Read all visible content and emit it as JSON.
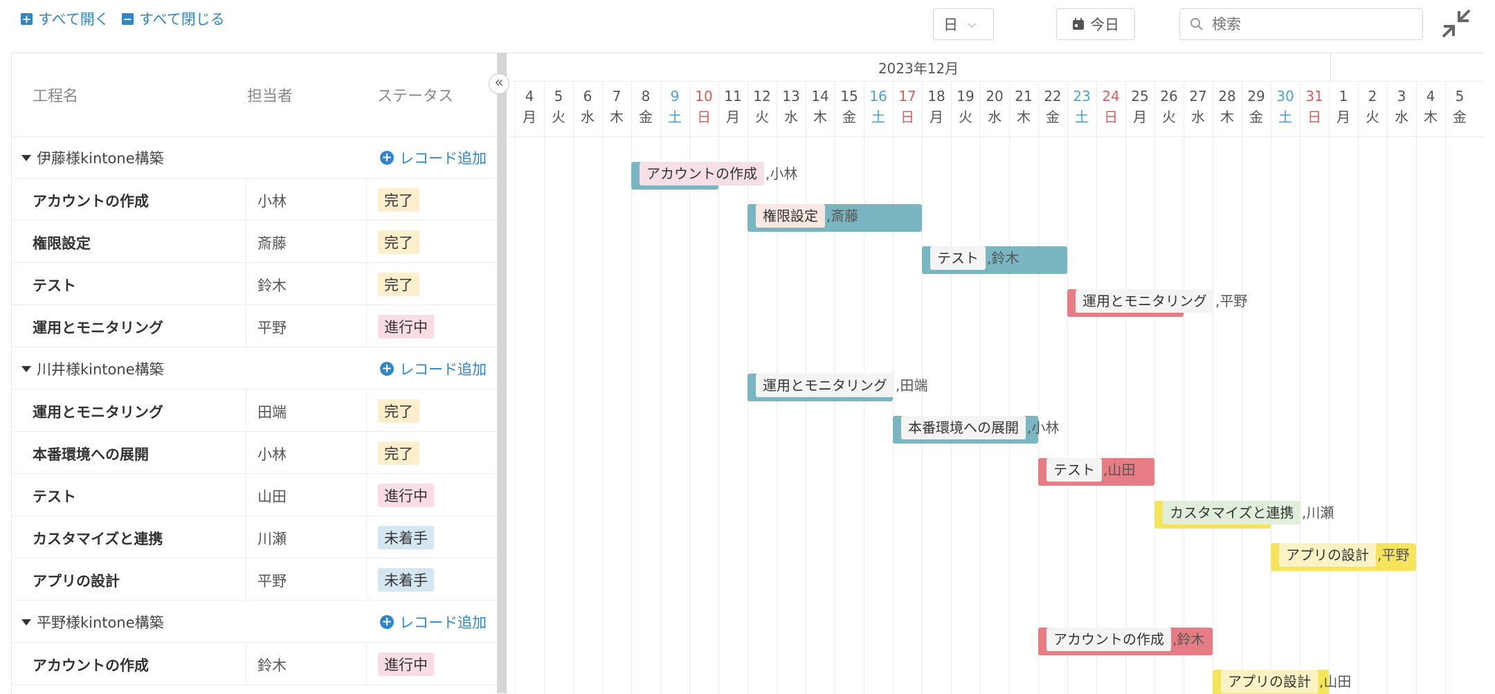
{
  "toolbar": {
    "expand_all": "すべて開く",
    "collapse_all": "すべて閉じる",
    "scale": "日",
    "today": "今日",
    "search_placeholder": "検索"
  },
  "columns": {
    "process": "工程名",
    "assignee": "担当者",
    "status": "ステータス"
  },
  "add_record": "レコード追加",
  "groups": [
    {
      "title": "伊藤様kintone構築",
      "rows": [
        {
          "name": "アカウントの作成",
          "assignee": "小林",
          "status": "完了",
          "kind": "done"
        },
        {
          "name": "権限設定",
          "assignee": "斎藤",
          "status": "完了",
          "kind": "done"
        },
        {
          "name": "テスト",
          "assignee": "鈴木",
          "status": "完了",
          "kind": "done"
        },
        {
          "name": "運用とモニタリング",
          "assignee": "平野",
          "status": "進行中",
          "kind": "prog"
        }
      ]
    },
    {
      "title": "川井様kintone構築",
      "rows": [
        {
          "name": "運用とモニタリング",
          "assignee": "田端",
          "status": "完了",
          "kind": "done"
        },
        {
          "name": "本番環境への展開",
          "assignee": "小林",
          "status": "完了",
          "kind": "done"
        },
        {
          "name": "テスト",
          "assignee": "山田",
          "status": "進行中",
          "kind": "prog"
        },
        {
          "name": "カスタマイズと連携",
          "assignee": "川瀬",
          "status": "未着手",
          "kind": "todo"
        },
        {
          "name": "アプリの設計",
          "assignee": "平野",
          "status": "未着手",
          "kind": "todo"
        }
      ]
    },
    {
      "title": "平野様kintone構築",
      "rows": [
        {
          "name": "アカウントの作成",
          "assignee": "鈴木",
          "status": "進行中",
          "kind": "prog"
        }
      ]
    }
  ],
  "gantt": {
    "month_label": "2023年12月",
    "days": [
      {
        "d": "4",
        "w": "月"
      },
      {
        "d": "5",
        "w": "火"
      },
      {
        "d": "6",
        "w": "水"
      },
      {
        "d": "7",
        "w": "木"
      },
      {
        "d": "8",
        "w": "金"
      },
      {
        "d": "9",
        "w": "土",
        "t": "sat"
      },
      {
        "d": "10",
        "w": "日",
        "t": "sun"
      },
      {
        "d": "11",
        "w": "月"
      },
      {
        "d": "12",
        "w": "火"
      },
      {
        "d": "13",
        "w": "水"
      },
      {
        "d": "14",
        "w": "木"
      },
      {
        "d": "15",
        "w": "金"
      },
      {
        "d": "16",
        "w": "土",
        "t": "sat"
      },
      {
        "d": "17",
        "w": "日",
        "t": "sun"
      },
      {
        "d": "18",
        "w": "月"
      },
      {
        "d": "19",
        "w": "火"
      },
      {
        "d": "20",
        "w": "水"
      },
      {
        "d": "21",
        "w": "木"
      },
      {
        "d": "22",
        "w": "金"
      },
      {
        "d": "23",
        "w": "土",
        "t": "sat"
      },
      {
        "d": "24",
        "w": "日",
        "t": "sun"
      },
      {
        "d": "25",
        "w": "月"
      },
      {
        "d": "26",
        "w": "火"
      },
      {
        "d": "27",
        "w": "水"
      },
      {
        "d": "28",
        "w": "木"
      },
      {
        "d": "29",
        "w": "金"
      },
      {
        "d": "30",
        "w": "土",
        "t": "sat"
      },
      {
        "d": "31",
        "w": "日",
        "t": "sun"
      },
      {
        "d": "1",
        "w": "月"
      },
      {
        "d": "2",
        "w": "火"
      },
      {
        "d": "3",
        "w": "水"
      },
      {
        "d": "4",
        "w": "木"
      },
      {
        "d": "5",
        "w": "金"
      }
    ],
    "bars": [
      {
        "label": "アカウントの作成",
        "who": "小林",
        "color": "teal",
        "labelBg": "#f6dfe6",
        "start": 4,
        "end": 7
      },
      {
        "label": "権限設定",
        "who": "斎藤",
        "color": "teal",
        "labelBg": "#fbe9e1",
        "start": 8,
        "end": 14
      },
      {
        "label": "テスト",
        "who": "鈴木",
        "color": "teal",
        "labelBg": "#f4f4f4",
        "start": 14,
        "end": 19
      },
      {
        "label": "運用とモニタリング",
        "who": "平野",
        "color": "red",
        "labelBg": "#f4f4f4",
        "start": 19,
        "end": 23
      },
      {
        "label": "運用とモニタリング",
        "who": "田端",
        "color": "teal",
        "labelBg": "#f4f4f4",
        "start": 8,
        "end": 13
      },
      {
        "label": "本番環境への展開",
        "who": "小林",
        "color": "teal",
        "labelBg": "#f4f4f4",
        "start": 13,
        "end": 18
      },
      {
        "label": "テスト",
        "who": "山田",
        "color": "red",
        "labelBg": "#f4f4f4",
        "start": 18,
        "end": 22
      },
      {
        "label": "カスタマイズと連携",
        "who": "川瀬",
        "color": "yellow",
        "labelBg": "#e0efdc",
        "start": 22,
        "end": 26
      },
      {
        "label": "アプリの設計",
        "who": "平野",
        "color": "yellow",
        "labelBg": "#fbf3c4",
        "start": 26,
        "end": 31
      },
      {
        "label": "アカウントの作成",
        "who": "鈴木",
        "color": "red",
        "labelBg": "#f4f4f4",
        "start": 18,
        "end": 24
      },
      {
        "label": "アプリの設計",
        "who": "山田",
        "color": "yellow",
        "labelBg": "#fbf3c4",
        "start": 24,
        "end": 28
      }
    ]
  }
}
